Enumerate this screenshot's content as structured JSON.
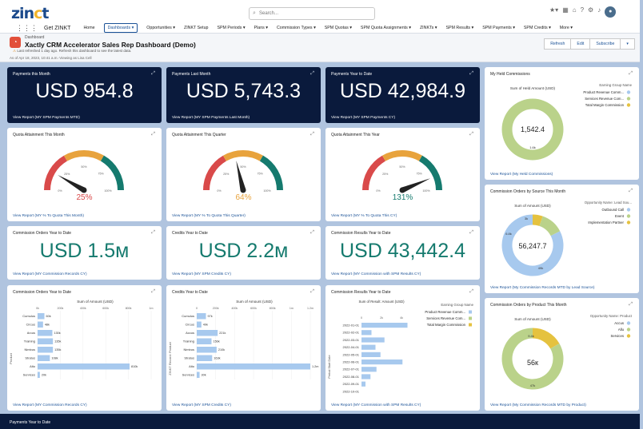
{
  "app": {
    "logo_main": "zin",
    "logo_accent": "c",
    "logo_end": "t",
    "name": "Get ZINKT"
  },
  "search": {
    "placeholder": "Search..."
  },
  "nav": [
    "Home",
    "Dashboards",
    "Opportunities",
    "ZINKT Setup",
    "SPM Periods",
    "Plans",
    "Commission Types",
    "SPM Quotas",
    "SPM Quota Assignments",
    "ZINKTs",
    "SPM Results",
    "SPM Payments",
    "SPM Credits",
    "More"
  ],
  "header": {
    "small": "Dashboard",
    "title": "Xactly CRM Accelerator Sales Rep Dashboard (Demo)",
    "sub": "Last refreshed 1 day ago. Refresh this dashboard to see the latest data.",
    "asof": "As of Apr 18, 2023, 10:41 a.m.·Viewing as Lisa Cell",
    "buttons": [
      "Refresh",
      "Edit",
      "Subscribe",
      "▾"
    ]
  },
  "colors": {
    "brand": "#1b4a8c",
    "dark": "#0a1a3c",
    "teal": "#157a6e",
    "bar": "#a7c9ee"
  },
  "cards": {
    "pm": {
      "title": "Payments this Month",
      "value": "USD 954.8",
      "link": "View Report (MY SPM Payments MTD)"
    },
    "plm": {
      "title": "Payments Last Month",
      "value": "USD 5,743.3",
      "link": "View Report (MY SPM Payments Last Month)"
    },
    "pytd": {
      "title": "Payments Year to Date",
      "value": "USD 42,984.9",
      "link": "View Report (MY SPM Payments CY)"
    },
    "held": {
      "title": "My Held Commissions",
      "link": "View Report (My Held Commissions)",
      "chart_title": "Sum of Held Amount (USD)",
      "center": "1,542.4",
      "legend_title": "Earning Group Name",
      "legend": [
        "Product Revenue Comm...",
        "Services Revenue Com...",
        "Total Margin Commission"
      ],
      "slice_label": "1.6k"
    },
    "qatm": {
      "title": "Quota Attainment This Month",
      "value": "25%",
      "link": "View Report (MY % To Quota This Month)"
    },
    "qatq": {
      "title": "Quota Attainment This Quarter",
      "value": "64%",
      "link": "View Report (MY % To Quota This Quarter)"
    },
    "qaty": {
      "title": "Quota Attainment This Year",
      "value": "131%",
      "link": "View Report (MY % To Quota This CY)"
    },
    "cobs": {
      "title": "Commission Orders by Source This Month",
      "link": "View Report (My Commission Records MTD by Lead Source)",
      "chart_title": "Sum of Amount (USD)",
      "center": "56,247.7",
      "legend_title": "Opportunity Name: Lead Sou...",
      "legend": [
        "Outbound Call",
        "Event",
        "Implementation Partner"
      ],
      "labels": [
        "3k",
        "6.8k",
        "49k"
      ]
    },
    "coytd": {
      "title": "Commission Orders Year to Date",
      "value": "USD 1.5м",
      "link": "View Report (MY Commission Records CY)"
    },
    "crytd": {
      "title": "Credits Year to Date",
      "value": "USD 2.2м",
      "link": "View Report (MY SPM Credits CY)"
    },
    "cresytd": {
      "title": "Commission Results Year to Date",
      "value": "USD 43,442.4",
      "link": "View Report (MY Commission with SPM Results CY)"
    },
    "cobp": {
      "title": "Commission Orders by Product This Month",
      "link": "View Report (My Commission Records MTD by Product)",
      "chart_title": "Sum of Amount (USD)",
      "center": "56к",
      "legend_title": "Opportunity Name: Product",
      "legend": [
        "Accus",
        "Allu",
        "Services"
      ],
      "labels": [
        "9.4k",
        "47k"
      ]
    },
    "bottom": {
      "title": "Payments Year to Date"
    }
  },
  "chart_data": [
    {
      "type": "bar",
      "title": "Sum of Amount (USD)",
      "ylabel": "Product",
      "categories": [
        "Cumulus",
        "Circus",
        "Arcus",
        "Training",
        "Nimbus",
        "Stratus",
        "Alto",
        "Services"
      ],
      "values": [
        60000,
        48000,
        130000,
        135000,
        135000,
        108000,
        810000,
        20000
      ],
      "value_labels": [
        "60k",
        "48k",
        "130k",
        "135k",
        "135k",
        "108k",
        "810k",
        "20k"
      ],
      "xticks": [
        "0k",
        "200k",
        "400k",
        "600k",
        "800k",
        "1m"
      ]
    },
    {
      "type": "bar",
      "title": "Sum of Amount (USD)",
      "ylabel": "ZINKT Record: Product",
      "categories": [
        "Cumulus",
        "Circus",
        "Accus",
        "Training",
        "Nimbus",
        "Stratus",
        "Alto",
        "Services"
      ],
      "values": [
        97000,
        49000,
        221000,
        156000,
        210000,
        163000,
        1200000,
        30000
      ],
      "value_labels": [
        "97k",
        "49k",
        "221k",
        "156k",
        "210k",
        "163k",
        "1.2m",
        "30k"
      ],
      "xticks": [
        "0",
        "200k",
        "400k",
        "600k",
        "800k",
        "1m",
        "1.2m"
      ]
    },
    {
      "type": "bar",
      "title": "Sum of Result: Amount (USD)",
      "ylabel": "Period Start Date",
      "categories": [
        "2022-01-01",
        "2022-02-01",
        "2022-03-01",
        "2022-04-01",
        "2022-05-01",
        "2022-06-01",
        "2022-07-01",
        "2022-08-01",
        "2022-09-01",
        "2022-10-01"
      ],
      "values": [
        4600,
        1000,
        2300,
        1400,
        1900,
        4100,
        1500,
        900,
        400,
        0
      ],
      "xticks": [
        "0",
        "2k",
        "4k"
      ],
      "legend_title": "Earning Group Name",
      "legend": [
        "Product Revenue Comm...",
        "Services Revenue Com...",
        "Total Margin Commission"
      ]
    },
    {
      "type": "gauge",
      "name": "Quota Attainment This Month",
      "value": 25
    },
    {
      "type": "gauge",
      "name": "Quota Attainment This Quarter",
      "value": 64
    },
    {
      "type": "gauge",
      "name": "Quota Attainment This Year",
      "value": 131
    },
    {
      "type": "pie",
      "name": "My Held Commissions",
      "values": [
        1542.4
      ]
    },
    {
      "type": "pie",
      "name": "Commission Orders by Source This Month",
      "values": [
        3000,
        6800,
        46447.7
      ],
      "labels": [
        "Outbound Call",
        "Event",
        "Implementation Partner"
      ]
    },
    {
      "type": "pie",
      "name": "Commission Orders by Product This Month",
      "values": [
        9400,
        46600
      ],
      "labels": [
        "Accus",
        "Allu"
      ]
    }
  ]
}
